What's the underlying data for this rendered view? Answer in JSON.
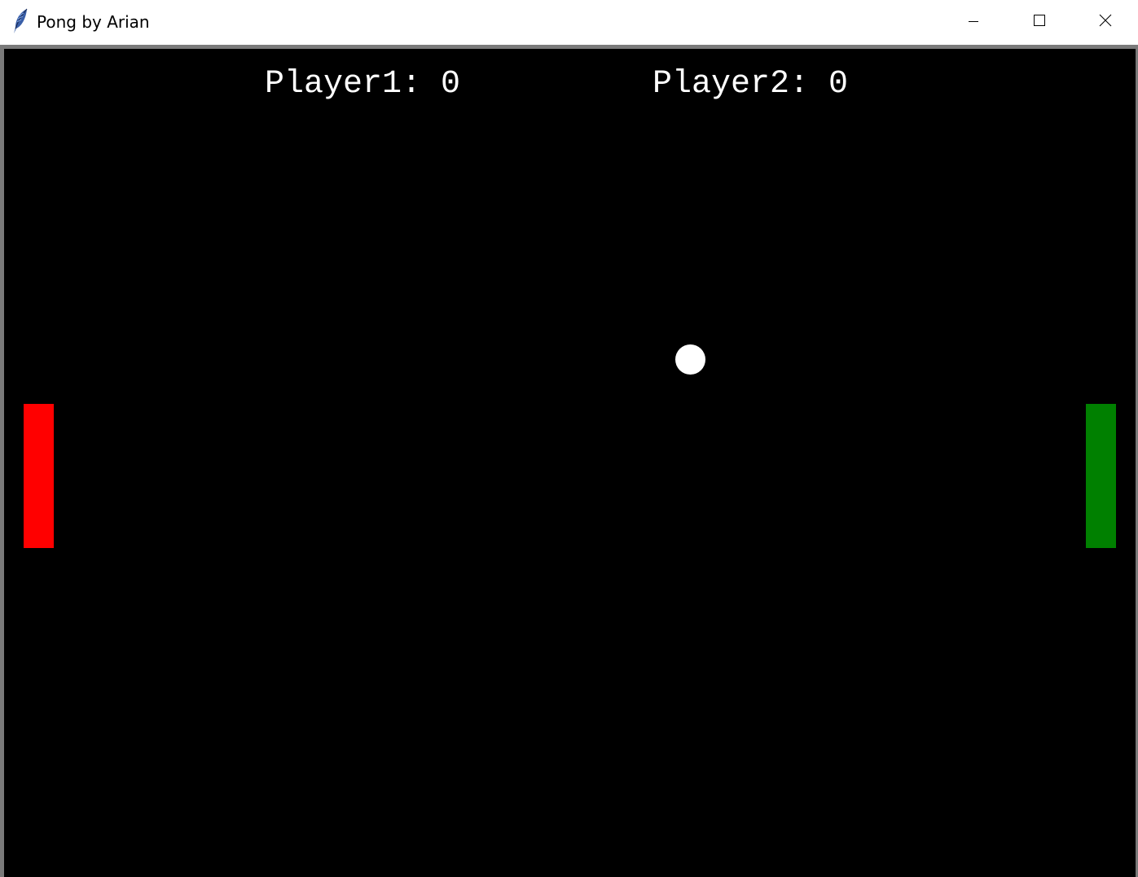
{
  "window": {
    "title": "Pong by Arian",
    "icon": "feather-icon",
    "controls": {
      "minimize_icon": "minimize-icon",
      "maximize_icon": "maximize-icon",
      "close_icon": "close-icon"
    }
  },
  "game": {
    "background_color": "#000000",
    "player1": {
      "label": "Player1:",
      "score": "0",
      "paddle_color": "#ff0000"
    },
    "player2": {
      "label": "Player2:",
      "score": "0",
      "paddle_color": "#008000"
    },
    "ball_color": "#ffffff"
  }
}
